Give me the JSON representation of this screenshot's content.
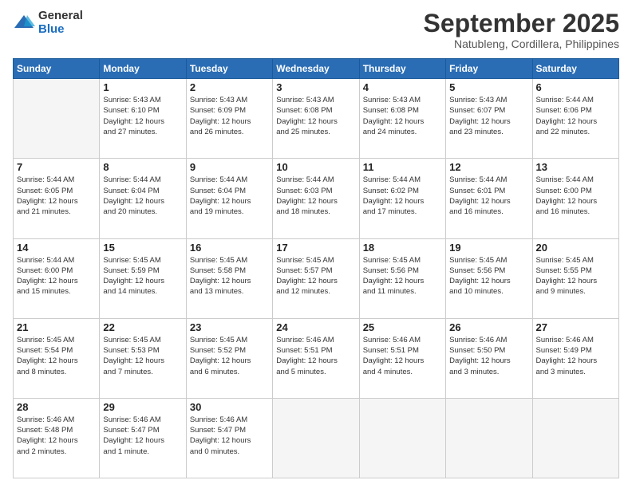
{
  "header": {
    "logo_general": "General",
    "logo_blue": "Blue",
    "month_title": "September 2025",
    "subtitle": "Natubleng, Cordillera, Philippines"
  },
  "weekdays": [
    "Sunday",
    "Monday",
    "Tuesday",
    "Wednesday",
    "Thursday",
    "Friday",
    "Saturday"
  ],
  "weeks": [
    [
      {
        "day": "",
        "info": ""
      },
      {
        "day": "1",
        "info": "Sunrise: 5:43 AM\nSunset: 6:10 PM\nDaylight: 12 hours\nand 27 minutes."
      },
      {
        "day": "2",
        "info": "Sunrise: 5:43 AM\nSunset: 6:09 PM\nDaylight: 12 hours\nand 26 minutes."
      },
      {
        "day": "3",
        "info": "Sunrise: 5:43 AM\nSunset: 6:08 PM\nDaylight: 12 hours\nand 25 minutes."
      },
      {
        "day": "4",
        "info": "Sunrise: 5:43 AM\nSunset: 6:08 PM\nDaylight: 12 hours\nand 24 minutes."
      },
      {
        "day": "5",
        "info": "Sunrise: 5:43 AM\nSunset: 6:07 PM\nDaylight: 12 hours\nand 23 minutes."
      },
      {
        "day": "6",
        "info": "Sunrise: 5:44 AM\nSunset: 6:06 PM\nDaylight: 12 hours\nand 22 minutes."
      }
    ],
    [
      {
        "day": "7",
        "info": "Sunrise: 5:44 AM\nSunset: 6:05 PM\nDaylight: 12 hours\nand 21 minutes."
      },
      {
        "day": "8",
        "info": "Sunrise: 5:44 AM\nSunset: 6:04 PM\nDaylight: 12 hours\nand 20 minutes."
      },
      {
        "day": "9",
        "info": "Sunrise: 5:44 AM\nSunset: 6:04 PM\nDaylight: 12 hours\nand 19 minutes."
      },
      {
        "day": "10",
        "info": "Sunrise: 5:44 AM\nSunset: 6:03 PM\nDaylight: 12 hours\nand 18 minutes."
      },
      {
        "day": "11",
        "info": "Sunrise: 5:44 AM\nSunset: 6:02 PM\nDaylight: 12 hours\nand 17 minutes."
      },
      {
        "day": "12",
        "info": "Sunrise: 5:44 AM\nSunset: 6:01 PM\nDaylight: 12 hours\nand 16 minutes."
      },
      {
        "day": "13",
        "info": "Sunrise: 5:44 AM\nSunset: 6:00 PM\nDaylight: 12 hours\nand 16 minutes."
      }
    ],
    [
      {
        "day": "14",
        "info": "Sunrise: 5:44 AM\nSunset: 6:00 PM\nDaylight: 12 hours\nand 15 minutes."
      },
      {
        "day": "15",
        "info": "Sunrise: 5:45 AM\nSunset: 5:59 PM\nDaylight: 12 hours\nand 14 minutes."
      },
      {
        "day": "16",
        "info": "Sunrise: 5:45 AM\nSunset: 5:58 PM\nDaylight: 12 hours\nand 13 minutes."
      },
      {
        "day": "17",
        "info": "Sunrise: 5:45 AM\nSunset: 5:57 PM\nDaylight: 12 hours\nand 12 minutes."
      },
      {
        "day": "18",
        "info": "Sunrise: 5:45 AM\nSunset: 5:56 PM\nDaylight: 12 hours\nand 11 minutes."
      },
      {
        "day": "19",
        "info": "Sunrise: 5:45 AM\nSunset: 5:56 PM\nDaylight: 12 hours\nand 10 minutes."
      },
      {
        "day": "20",
        "info": "Sunrise: 5:45 AM\nSunset: 5:55 PM\nDaylight: 12 hours\nand 9 minutes."
      }
    ],
    [
      {
        "day": "21",
        "info": "Sunrise: 5:45 AM\nSunset: 5:54 PM\nDaylight: 12 hours\nand 8 minutes."
      },
      {
        "day": "22",
        "info": "Sunrise: 5:45 AM\nSunset: 5:53 PM\nDaylight: 12 hours\nand 7 minutes."
      },
      {
        "day": "23",
        "info": "Sunrise: 5:45 AM\nSunset: 5:52 PM\nDaylight: 12 hours\nand 6 minutes."
      },
      {
        "day": "24",
        "info": "Sunrise: 5:46 AM\nSunset: 5:51 PM\nDaylight: 12 hours\nand 5 minutes."
      },
      {
        "day": "25",
        "info": "Sunrise: 5:46 AM\nSunset: 5:51 PM\nDaylight: 12 hours\nand 4 minutes."
      },
      {
        "day": "26",
        "info": "Sunrise: 5:46 AM\nSunset: 5:50 PM\nDaylight: 12 hours\nand 3 minutes."
      },
      {
        "day": "27",
        "info": "Sunrise: 5:46 AM\nSunset: 5:49 PM\nDaylight: 12 hours\nand 3 minutes."
      }
    ],
    [
      {
        "day": "28",
        "info": "Sunrise: 5:46 AM\nSunset: 5:48 PM\nDaylight: 12 hours\nand 2 minutes."
      },
      {
        "day": "29",
        "info": "Sunrise: 5:46 AM\nSunset: 5:47 PM\nDaylight: 12 hours\nand 1 minute."
      },
      {
        "day": "30",
        "info": "Sunrise: 5:46 AM\nSunset: 5:47 PM\nDaylight: 12 hours\nand 0 minutes."
      },
      {
        "day": "",
        "info": ""
      },
      {
        "day": "",
        "info": ""
      },
      {
        "day": "",
        "info": ""
      },
      {
        "day": "",
        "info": ""
      }
    ]
  ]
}
